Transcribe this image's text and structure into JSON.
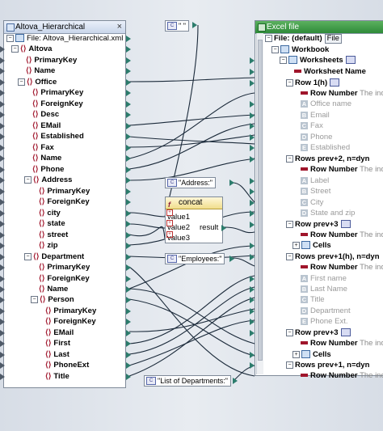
{
  "source_panel": {
    "title": "Altova_Hierarchical",
    "file_label": "File: Altova_Hierarchical.xml",
    "close_icon": "×",
    "items": {
      "altova": "Altova",
      "primarykey": "PrimaryKey",
      "name": "Name",
      "office": "Office",
      "office_primarykey": "PrimaryKey",
      "office_foreignkey": "ForeignKey",
      "desc": "Desc",
      "email": "EMail",
      "established": "Established",
      "fax": "Fax",
      "office_name": "Name",
      "phone": "Phone",
      "address": "Address",
      "address_primarykey": "PrimaryKey",
      "address_foreignkey": "ForeignKey",
      "city": "city",
      "state": "state",
      "street": "street",
      "zip": "zip",
      "department": "Department",
      "dept_primarykey": "PrimaryKey",
      "dept_foreignkey": "ForeignKey",
      "dept_name": "Name",
      "person": "Person",
      "person_primarykey": "PrimaryKey",
      "person_foreignkey": "ForeignKey",
      "person_email": "EMail",
      "first": "First",
      "last": "Last",
      "phoneext": "PhoneExt",
      "title": "Title"
    }
  },
  "constants": {
    "space": "\" \"",
    "address": "\"Address:\"",
    "employees": "\"Employees:\"",
    "departments": "\"List of Departments:\""
  },
  "concat": {
    "title": "concat",
    "icon": "f",
    "inputs": [
      "value1",
      "value2",
      "value3"
    ],
    "output": "result"
  },
  "excel_panel": {
    "title": "Excel file",
    "file_label": "File: (default)",
    "file_button": "File",
    "rows": {
      "workbook": "Workbook",
      "worksheets": "Worksheets",
      "worksheet_name": "Worksheet Name",
      "row1": "Row 1(h)",
      "row1_number": "Row Number",
      "row1_number_hint": "The indi",
      "a_office_name": "Office name",
      "b_email": "Email",
      "c_fax": "Fax",
      "d_phone": "Phone",
      "e_established": "Established",
      "rows_prev2": "Rows prev+2, n=dyn",
      "rows_prev2_number": "Row Number",
      "rows_prev2_hint": "The ind",
      "a_label": "Label",
      "b_street": "Street",
      "c_city": "City",
      "d_state_zip": "State and zip",
      "row_prev3a": "Row prev+3",
      "row_prev3a_number": "Row Number",
      "row_prev3a_hint": "The indi",
      "cells_a": "Cells",
      "rows_prev1": "Rows prev+1(h), n=dyn",
      "rows_prev1_number": "Row Number",
      "rows_prev1_hint": "The ind",
      "a_first_name": "First name",
      "b_last_name": "Last Name",
      "c_title": "Title",
      "d_department": "Department",
      "e_phone_ext": "Phone Ext.",
      "row_prev3b": "Row prev+3",
      "row_prev3b_number": "Row Number",
      "row_prev3b_hint": "The indi",
      "cells_b": "Cells",
      "rows_prev1b": "Rows prev+1, n=dyn",
      "rows_prev1b_number": "Row Number",
      "rows_prev1b_hint": "The ind"
    },
    "letters": [
      "A",
      "B",
      "C",
      "D",
      "E"
    ]
  },
  "colors": {
    "wire": "#1b2a3a",
    "element_icon": "#a0152b",
    "excel_title": "#2e8a39",
    "port": "#2c7c6c"
  }
}
